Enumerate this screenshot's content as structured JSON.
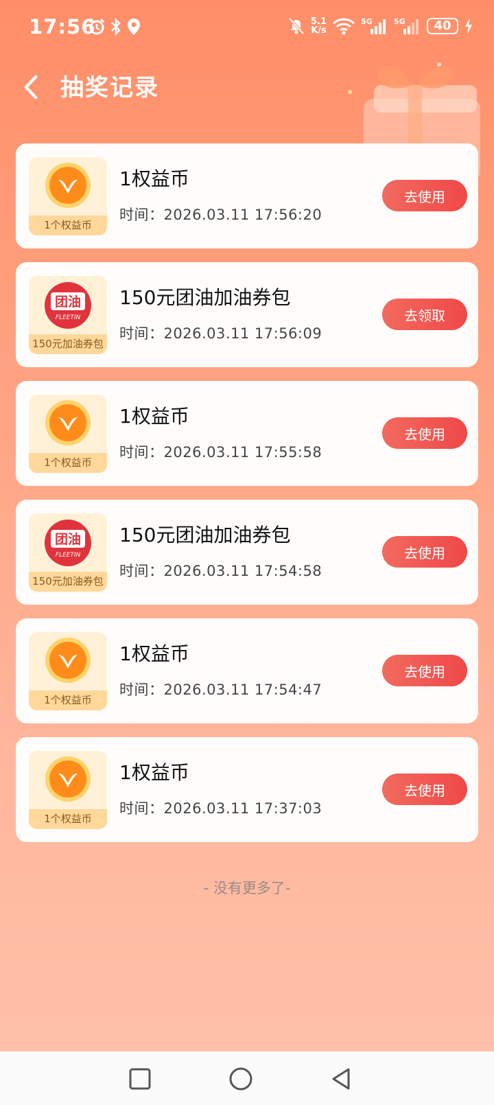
{
  "status": {
    "time": "17:56",
    "speed_top": "5.1",
    "speed_bottom": "K/s",
    "battery": "40"
  },
  "header": {
    "title": "抽奖记录"
  },
  "records": [
    {
      "icon": "coin",
      "thumb_caption": "1个权益币",
      "title": "1权益币",
      "time": "时间：2026.03.11 17:56:20",
      "action": "去使用"
    },
    {
      "icon": "fleetin",
      "thumb_caption": "150元加油券包",
      "title": "150元团油加油券包",
      "time": "时间：2026.03.11 17:56:09",
      "action": "去领取"
    },
    {
      "icon": "coin",
      "thumb_caption": "1个权益币",
      "title": "1权益币",
      "time": "时间：2026.03.11 17:55:58",
      "action": "去使用"
    },
    {
      "icon": "fleetin",
      "thumb_caption": "150元加油券包",
      "title": "150元团油加油券包",
      "time": "时间：2026.03.11 17:54:58",
      "action": "去使用"
    },
    {
      "icon": "coin",
      "thumb_caption": "1个权益币",
      "title": "1权益币",
      "time": "时间：2026.03.11 17:54:47",
      "action": "去使用"
    },
    {
      "icon": "coin",
      "thumb_caption": "1个权益币",
      "title": "1权益币",
      "time": "时间：2026.03.11 17:37:03",
      "action": "去使用"
    }
  ],
  "fleetin_logo": {
    "cn": "团油",
    "en": "FLEETIN"
  },
  "footer": {
    "no_more": "- 没有更多了-"
  },
  "colors": {
    "accent": "#f04848",
    "bg_top": "#ff8e68",
    "bg_bottom": "#ffc2ab"
  }
}
